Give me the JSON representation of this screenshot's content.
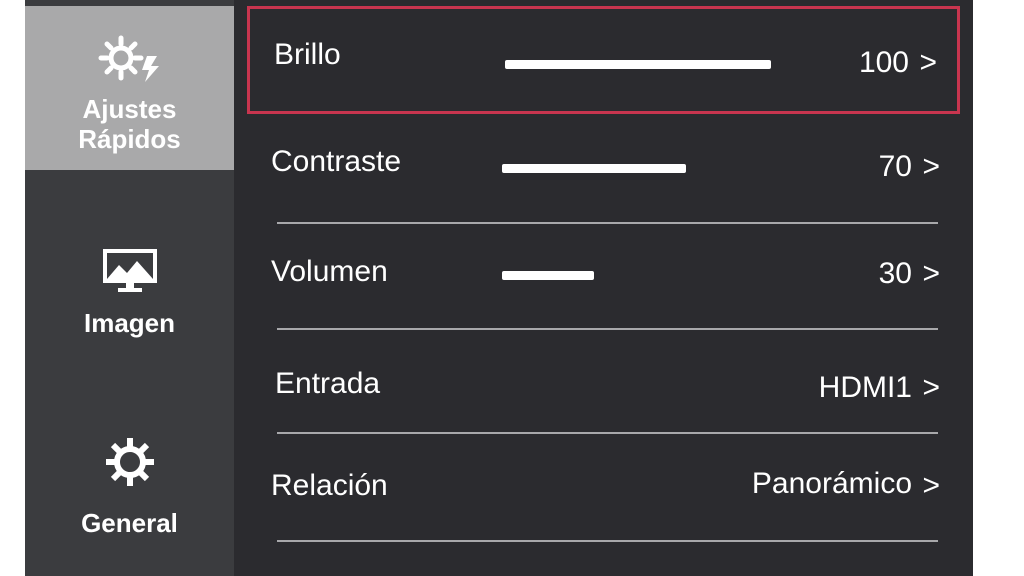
{
  "sidebar": {
    "items": [
      {
        "label_line1": "Ajustes",
        "label_line2": "Rápidos",
        "icon": "quick-settings-icon",
        "active": true
      },
      {
        "label": "Imagen",
        "icon": "picture-icon",
        "active": false
      },
      {
        "label": "General",
        "icon": "gear-icon",
        "active": false
      }
    ]
  },
  "settings": [
    {
      "label": "Brillo",
      "value": "100",
      "level": 100,
      "selected": true
    },
    {
      "label": "Contraste",
      "value": "70",
      "level": 70
    },
    {
      "label": "Volumen",
      "value": "30",
      "level": 30
    },
    {
      "label": "Entrada",
      "value": "HDMI1"
    },
    {
      "label": "Relación",
      "value": "Panorámico"
    }
  ],
  "chevron": ">",
  "colors": {
    "panel": "#2b2b2f",
    "sidebar": "#3b3c3f",
    "sidebar_active": "#a9a9aa",
    "selection": "#c8354f",
    "text": "#ffffff"
  }
}
